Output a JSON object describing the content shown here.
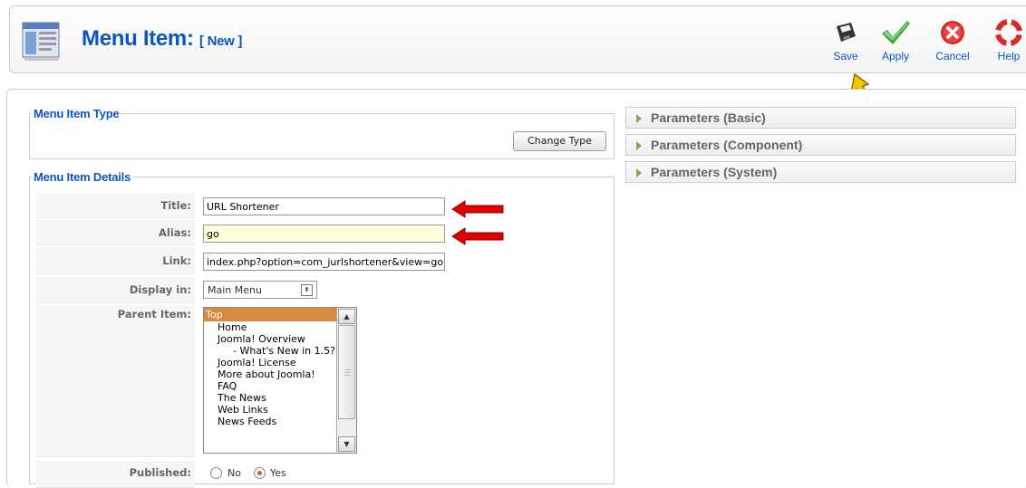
{
  "header": {
    "title": "Menu Item:",
    "subtitle": "[ New ]"
  },
  "toolbar": {
    "save": "Save",
    "apply": "Apply",
    "cancel": "Cancel",
    "help": "Help"
  },
  "menu_item_type": {
    "legend": "Menu Item Type",
    "change_button": "Change Type"
  },
  "details": {
    "legend": "Menu Item Details",
    "title_label": "Title:",
    "title_value": "URL Shortener",
    "alias_label": "Alias:",
    "alias_value": "go",
    "link_label": "Link:",
    "link_value": "index.php?option=com_jurlshortener&view=go",
    "display_label": "Display in:",
    "display_value": "Main Menu",
    "parent_label": "Parent Item:",
    "parent_options": [
      "Top",
      "Home",
      "Joomla! Overview",
      "- What's New in 1.5?",
      "Joomla! License",
      "More about Joomla!",
      "FAQ",
      "The News",
      "Web Links",
      "News Feeds"
    ],
    "published_label": "Published:",
    "published_no": "No",
    "published_yes": "Yes",
    "published_value": "Yes"
  },
  "parameters": [
    "Parameters (Basic)",
    "Parameters (Component)",
    "Parameters (System)"
  ],
  "colors": {
    "accent": "#0b55c4",
    "selected_option": "#d98a3e",
    "alias_field": "#ffffdd"
  }
}
